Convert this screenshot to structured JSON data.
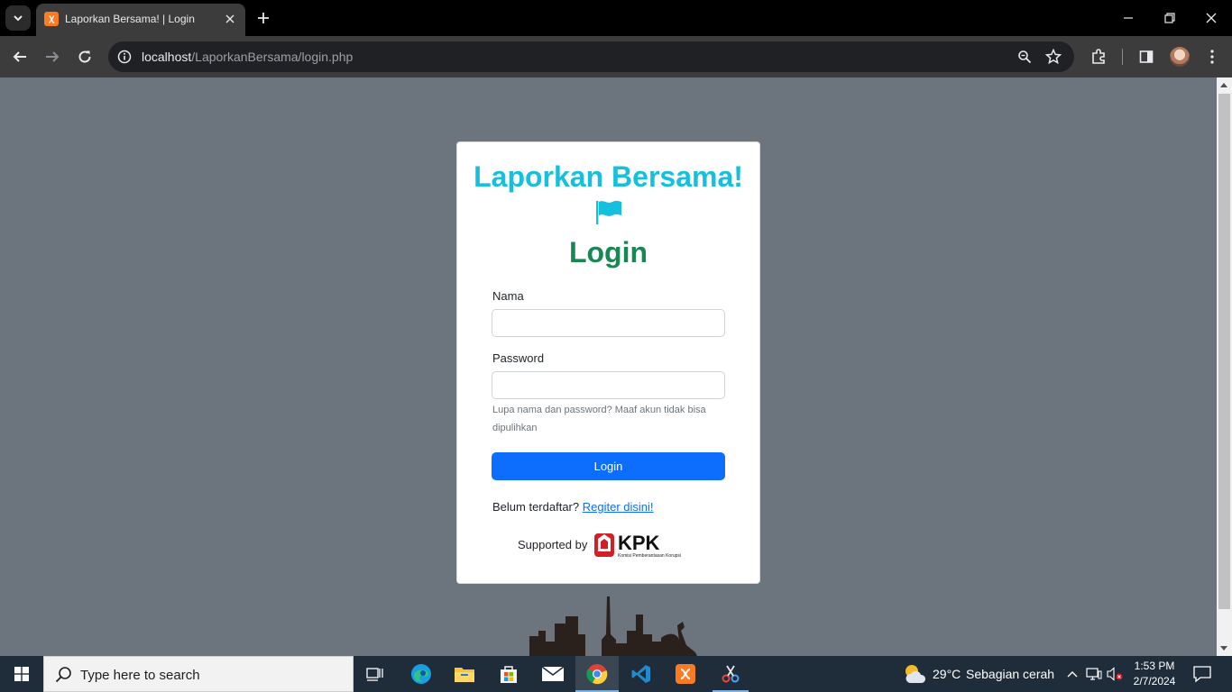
{
  "browser": {
    "tab": {
      "title": "Laporkan Bersama! | Login",
      "favicon": "xampp-icon"
    },
    "address": {
      "host": "localhost",
      "path": "/LaporkanBersama/login.php"
    }
  },
  "page": {
    "app_title": "Laporkan Bersama!",
    "login_heading": "Login",
    "name_label": "Nama",
    "name_value": "",
    "password_label": "Password",
    "password_value": "",
    "help_text": "Lupa nama dan password? Maaf akun tidak bisa dipulihkan",
    "login_button": "Login",
    "register_prompt": "Belum terdaftar?",
    "register_link": "Regiter disini!",
    "supported_by": "Supported by",
    "sponsor_logo_text": "KPK",
    "sponsor_logo_subtext": "Komisi Pemberantasan Korupsi"
  },
  "taskbar": {
    "search_placeholder": "Type here to search",
    "apps": [
      "task-view",
      "edge",
      "file-explorer",
      "microsoft-store",
      "mail",
      "chrome",
      "vscode",
      "xampp",
      "snipping-tool"
    ],
    "weather": {
      "temp": "29°C",
      "desc": "Sebagian cerah"
    },
    "clock": {
      "time": "1:53 PM",
      "date": "2/7/2024"
    }
  },
  "colors": {
    "page_bg": "#6c757d",
    "brand_title": "#17bfde",
    "login_heading": "#198754",
    "primary_button": "#0d6efd",
    "link": "#0d6efd"
  }
}
